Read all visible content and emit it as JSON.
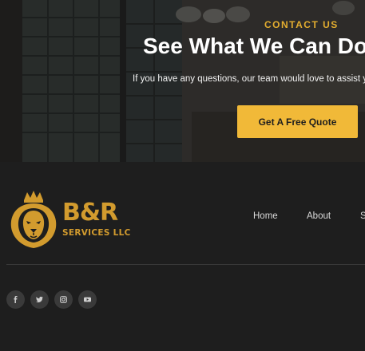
{
  "hero": {
    "eyebrow": "CONTACT US",
    "title": "See What We Can Do",
    "text": "If you have any questions, our team would love to assist you",
    "cta_label": "Get A Free Quote"
  },
  "footer": {
    "brand": {
      "name": "B&R",
      "subtitle": "SERVICES LLC",
      "logo_icon": "lion-crown-icon"
    },
    "nav": {
      "home": "Home",
      "about": "About",
      "more": "S"
    },
    "social": [
      {
        "icon": "facebook-icon"
      },
      {
        "icon": "twitter-icon"
      },
      {
        "icon": "instagram-icon"
      },
      {
        "icon": "youtube-icon"
      }
    ]
  },
  "colors": {
    "accent": "#f1b938",
    "gold_logo": "#d29b2e",
    "background": "#1e1e1e",
    "social_bg": "#3a3a3a"
  }
}
